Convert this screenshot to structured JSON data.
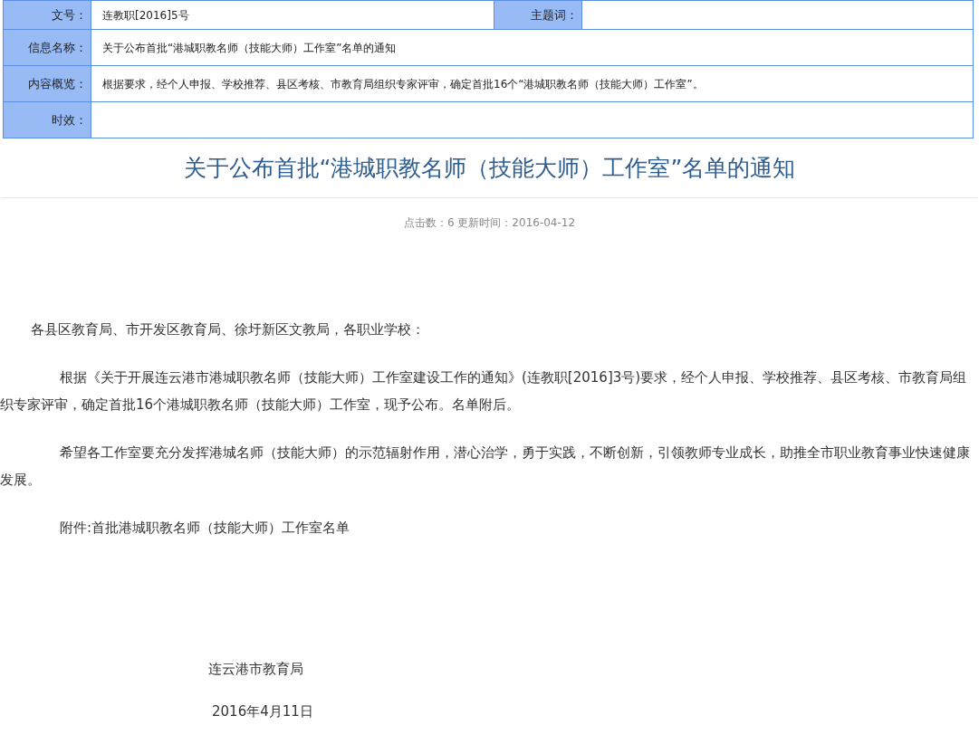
{
  "info_table": {
    "rows": [
      {
        "cells": [
          {
            "label": "文号：",
            "value": "连教职[2016]5号"
          },
          {
            "label": "主题词："
          }
        ]
      },
      {
        "cells": [
          {
            "label": "信息名称：",
            "value": "关于公布首批“港城职教名师（技能大师）工作室”名单的通知"
          }
        ]
      },
      {
        "cells": [
          {
            "label": "内容概览：",
            "value": "根据要求，经个人申报、学校推荐、县区考核、市教育局组织专家评审，确定首批16个“港城职教名师（技能大师）工作室”。"
          }
        ]
      },
      {
        "cells": [
          {
            "label": "时效："
          }
        ]
      }
    ]
  },
  "article": {
    "title": "关于公布首批“港城职教名师（技能大师）工作室”名单的通知",
    "meta": "点击数：6 更新时间：2016-04-12",
    "paragraphs": [
      {
        "kind": "salutation",
        "text": "各县区教育局、市开发区教育局、徐圩新区文教局，各职业学校："
      },
      {
        "kind": "body",
        "text": "根据《关于开展连云港市港城职教名师（技能大师）工作室建设工作的通知》(连教职[2016]3号)要求，经个人申报、学校推荐、县区考核、市教育局组织专家评审，确定首批16个港城职教名师（技能大师）工作室，现予公布。名单附后。"
      },
      {
        "kind": "body",
        "text": "希望各工作室要充分发挥港城名师（技能大师）的示范辐射作用，潜心治学，勇于实践，不断创新，引领教师专业成长，助推全市职业教育事业快速健康发展。"
      },
      {
        "kind": "body",
        "text": "附件:首批港城职教名师（技能大师）工作室名单"
      }
    ],
    "signature": {
      "org": "连云港市教育局",
      "date": "2016年4月11日"
    }
  }
}
